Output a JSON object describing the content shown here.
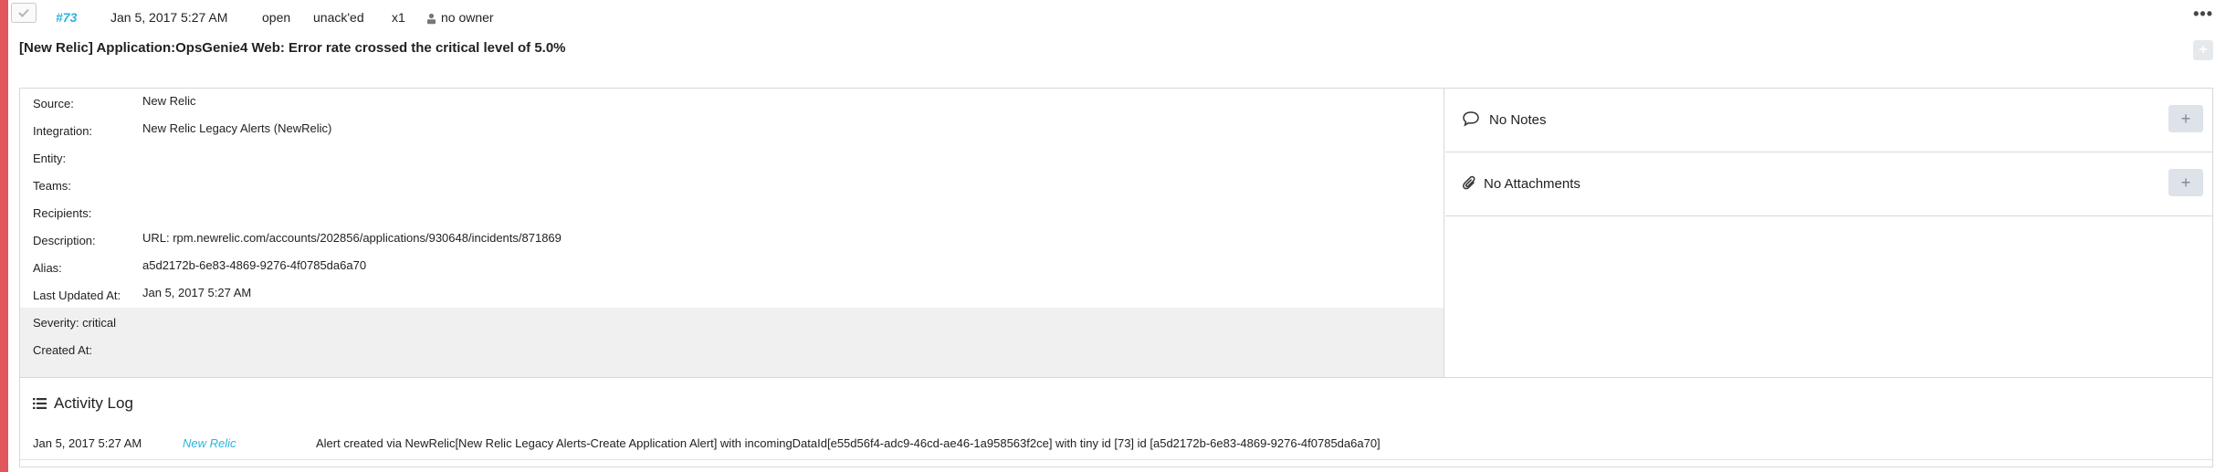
{
  "colors": {
    "accent": "#e0585b",
    "link": "#2bb4e0"
  },
  "header": {
    "checkbox_icon": "check-icon",
    "alert_id": "#73",
    "created": "Jan 5, 2017 5:27 AM",
    "status": "open",
    "ack_state": "unack'ed",
    "count": "x1",
    "owner_icon": "user-icon",
    "owner": "no owner",
    "more_label": "•••"
  },
  "title": "[New Relic] Application:OpsGenie4 Web: Error rate crossed the critical level of 5.0%",
  "add_tag_label": "+",
  "details": {
    "fields": [
      {
        "label": "Source:",
        "value": "New Relic"
      },
      {
        "label": "Integration:",
        "value": "New Relic Legacy Alerts (NewRelic)"
      },
      {
        "label": "Entity:",
        "value": ""
      },
      {
        "label": "Teams:",
        "value": ""
      },
      {
        "label": "Recipients:",
        "value": ""
      },
      {
        "label": "Description:",
        "value": "URL: rpm.newrelic.com/accounts/202856/applications/930648/incidents/871869"
      },
      {
        "label": "Alias:",
        "value": "a5d2172b-6e83-4869-9276-4f0785da6a70"
      },
      {
        "label": "Last Updated At:",
        "value": "Jan 5, 2017 5:27 AM"
      },
      {
        "label": "Severity: critical",
        "value": ""
      },
      {
        "label": "Created At:",
        "value": ""
      }
    ]
  },
  "side": {
    "notes": {
      "icon": "comment-icon",
      "label": "No Notes",
      "add_label": "+"
    },
    "attachments": {
      "icon": "paperclip-icon",
      "label": "No Attachments",
      "add_label": "+"
    }
  },
  "activity": {
    "icon": "list-icon",
    "title": "Activity Log",
    "entries": [
      {
        "time": "Jan 5, 2017 5:27 AM",
        "source": "New Relic",
        "message": "Alert created via NewRelic[New Relic Legacy Alerts-Create Application Alert] with incomingDataId[e55d56f4-adc9-46cd-ae46-1a958563f2ce] with tiny id [73] id [a5d2172b-6e83-4869-9276-4f0785da6a70]"
      }
    ]
  }
}
